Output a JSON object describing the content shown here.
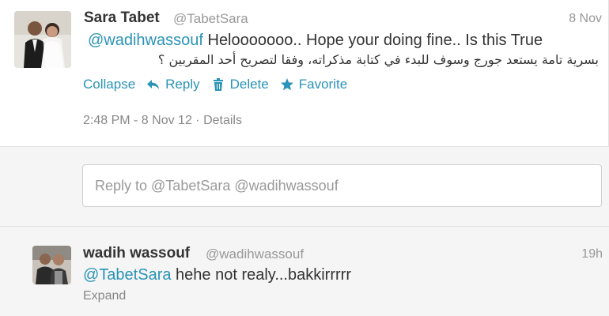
{
  "tweet": {
    "author_name": "Sara Tabet",
    "author_handle": "@TabetSara",
    "date": "8 Nov",
    "mention": "@wadihwassouf",
    "text": " Helooooooo.. Hope your doing fine.. Is this True",
    "text_arabic": "بسرية تامة يستعد جورج وسوف للبدء في كتابة مذكراته، وفقا لتصريح أحد المقربين ؟",
    "actions": {
      "collapse": "Collapse",
      "reply": "Reply",
      "delete": "Delete",
      "favorite": "Favorite"
    },
    "timestamp": "2:48 PM - 8 Nov 12",
    "separator": " · ",
    "details": "Details"
  },
  "reply_box": {
    "placeholder": "Reply to @TabetSara @wadihwassouf"
  },
  "reply_tweet": {
    "author_name": "wadih wassouf",
    "author_handle": "@wadihwassouf",
    "time": "19h",
    "mention": "@TabetSara",
    "text": " hehe not realy...bakkirrrrr",
    "expand": "Expand"
  },
  "colors": {
    "link": "#2a93b8",
    "text": "#333333",
    "muted": "#999999"
  },
  "icons": [
    "reply-arrow-icon",
    "trash-icon",
    "star-icon"
  ]
}
